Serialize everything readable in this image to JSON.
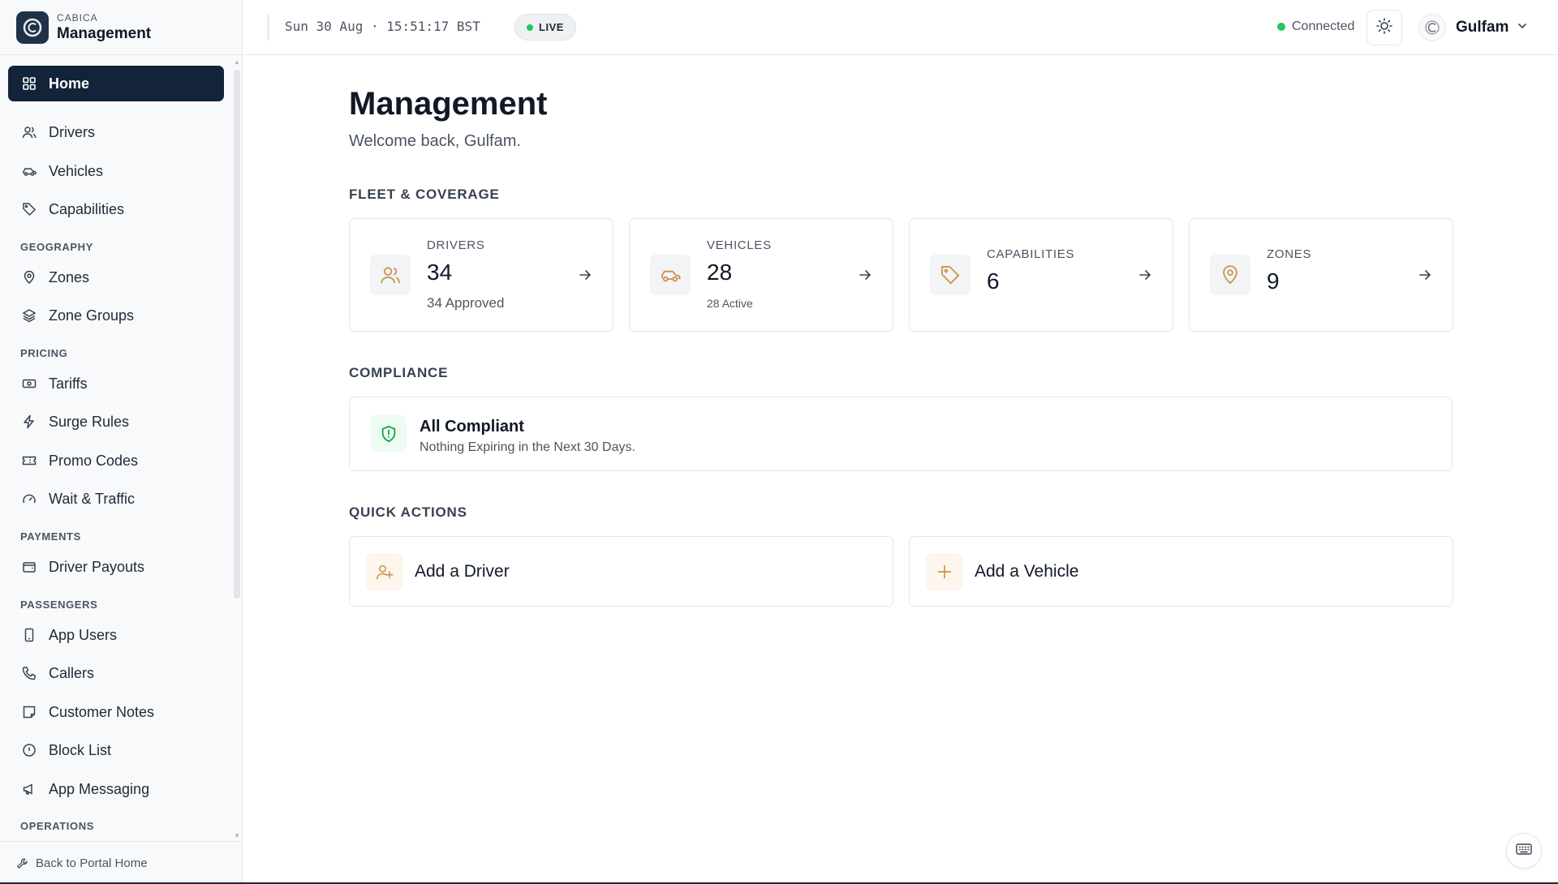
{
  "brand": {
    "small": "CABICA",
    "big": "Management",
    "logo_icon": "cabica-logo-icon"
  },
  "nav": {
    "home": "Home",
    "drivers": "Drivers",
    "vehicles": "Vehicles",
    "capabilities": "Capabilities",
    "section_geography": "GEOGRAPHY",
    "zones": "Zones",
    "zone_groups": "Zone Groups",
    "section_pricing": "PRICING",
    "tariffs": "Tariffs",
    "surge_rules": "Surge Rules",
    "promo_codes": "Promo Codes",
    "wait_traffic": "Wait & Traffic",
    "section_payments": "PAYMENTS",
    "driver_payouts": "Driver Payouts",
    "section_passengers": "PASSENGERS",
    "app_users": "App Users",
    "callers": "Callers",
    "customer_notes": "Customer Notes",
    "block_list": "Block List",
    "app_messaging": "App Messaging",
    "section_operations": "OPERATIONS",
    "back": "Back to Portal Home"
  },
  "topbar": {
    "clock": "Sun 30 Aug · 15:51:17 BST",
    "live": "LIVE",
    "connection": "Connected",
    "user": "Gulfam"
  },
  "page": {
    "title": "Management",
    "subtitle": "Welcome back, Gulfam."
  },
  "sections": {
    "fleet": "FLEET & COVERAGE",
    "compliance": "COMPLIANCE",
    "quick": "QUICK ACTIONS"
  },
  "stats": {
    "drivers": {
      "label": "DRIVERS",
      "value": "34",
      "sub": "34 Approved"
    },
    "vehicles": {
      "label": "VEHICLES",
      "value": "28",
      "sub": "28 Active"
    },
    "capabilities": {
      "label": "CAPABILITIES",
      "value": "6"
    },
    "zones": {
      "label": "ZONES",
      "value": "9"
    }
  },
  "compliance": {
    "title": "All Compliant",
    "sub": "Nothing Expiring in the Next 30 Days."
  },
  "quick_actions": {
    "add_driver": "Add a Driver",
    "add_vehicle": "Add a Vehicle"
  },
  "colors": {
    "accent": "#c9974f",
    "active_nav": "#12233a",
    "success": "#22c55e",
    "compliance_green": "#16a34a"
  }
}
